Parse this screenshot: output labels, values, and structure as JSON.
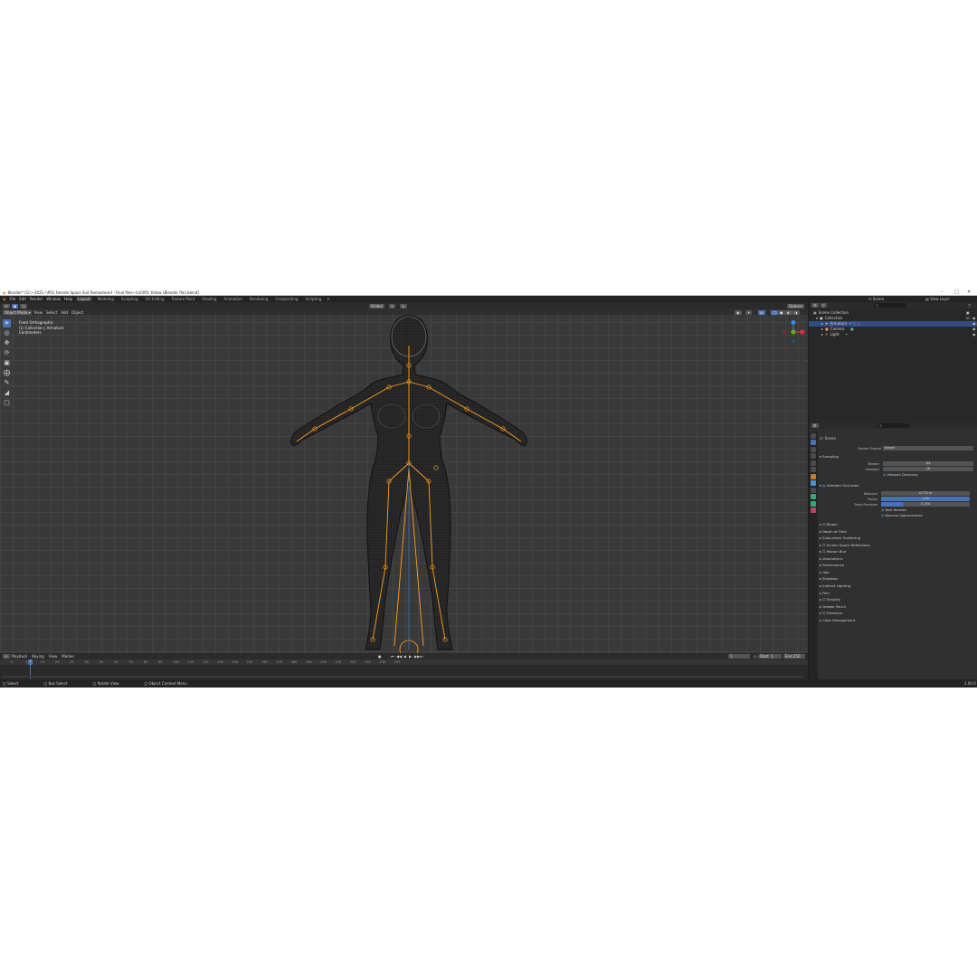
{
  "window": {
    "title": "Blender* [G:\\~2021~\\P01 Female Space Suit Remastered - Final files~\\v2\\P01 Yellow (Blender file).blend]",
    "controls": [
      "–",
      "□",
      "✕"
    ]
  },
  "menubar": {
    "menus": [
      "File",
      "Edit",
      "Render",
      "Window",
      "Help"
    ],
    "workspaces": [
      "Layout",
      "Modeling",
      "Sculpting",
      "UV Editing",
      "Texture Paint",
      "Shading",
      "Animation",
      "Rendering",
      "Compositing",
      "Scripting"
    ],
    "active_workspace": "Layout",
    "scene_label": "Scene",
    "view_layer_label": "View Layer"
  },
  "viewport": {
    "mode": "Object Mode",
    "menus": [
      "View",
      "Select",
      "Add",
      "Object"
    ],
    "transform_orientation": "Global",
    "options_label": "Options",
    "info_lines": [
      "Front Orthographic",
      "(1) Collection | Armature",
      "Centimeters"
    ],
    "gizmo": {
      "x_color": "#e8314b",
      "y_color": "#6aab21",
      "z_color": "#3f87dc"
    }
  },
  "timeline": {
    "menus": [
      "Playback",
      "Keying",
      "View",
      "Marker"
    ],
    "current_frame": "1",
    "start_label": "Start",
    "start_value": "1",
    "end_label": "End",
    "end_value": "250",
    "ticks": [
      "0",
      "5",
      "15",
      "25",
      "35",
      "45",
      "55",
      "65",
      "75",
      "85",
      "95",
      "105",
      "115",
      "125",
      "135",
      "145",
      "155",
      "165",
      "175",
      "185",
      "195",
      "205",
      "215",
      "225",
      "235",
      "245",
      "255"
    ]
  },
  "statusbar": {
    "items": [
      "Select",
      "Box Select",
      "Rotate View",
      "Object Context Menu"
    ],
    "version": "2.92.0"
  },
  "outliner": {
    "root": "Scene Collection",
    "collection": "Collection",
    "items": [
      "Armature",
      "Camera",
      "Light"
    ]
  },
  "properties": {
    "scene_label": "Scene",
    "render_engine_label": "Render Engine",
    "render_engine_value": "Eevee",
    "sampling_label": "Sampling",
    "render_label": "Render",
    "render_value": "64",
    "viewport_label": "Viewport",
    "viewport_value": "16",
    "viewport_denoising": "Viewport Denoising",
    "ao_label": "Ambient Occlusion",
    "distance_label": "Distance",
    "distance_value": "0.775 m",
    "factor_label": "Factor",
    "factor_value": "1.00",
    "trace_label": "Trace Precision",
    "trace_value": "0.250",
    "bent_normals": "Bent Normals",
    "bounces_approx": "Bounces Approximation",
    "sections": [
      "Bloom",
      "Depth of Field",
      "Subsurface Scattering",
      "Screen Space Reflections",
      "Motion Blur",
      "Volumetrics",
      "Performance",
      "Hair",
      "Shadows",
      "Indirect Lighting",
      "Film",
      "Simplify",
      "Grease Pencil",
      "Freestyle",
      "Color Management"
    ]
  },
  "colors": {
    "accent": "#4772b3",
    "bone": "#ff9f1c",
    "wire": "#111111"
  }
}
